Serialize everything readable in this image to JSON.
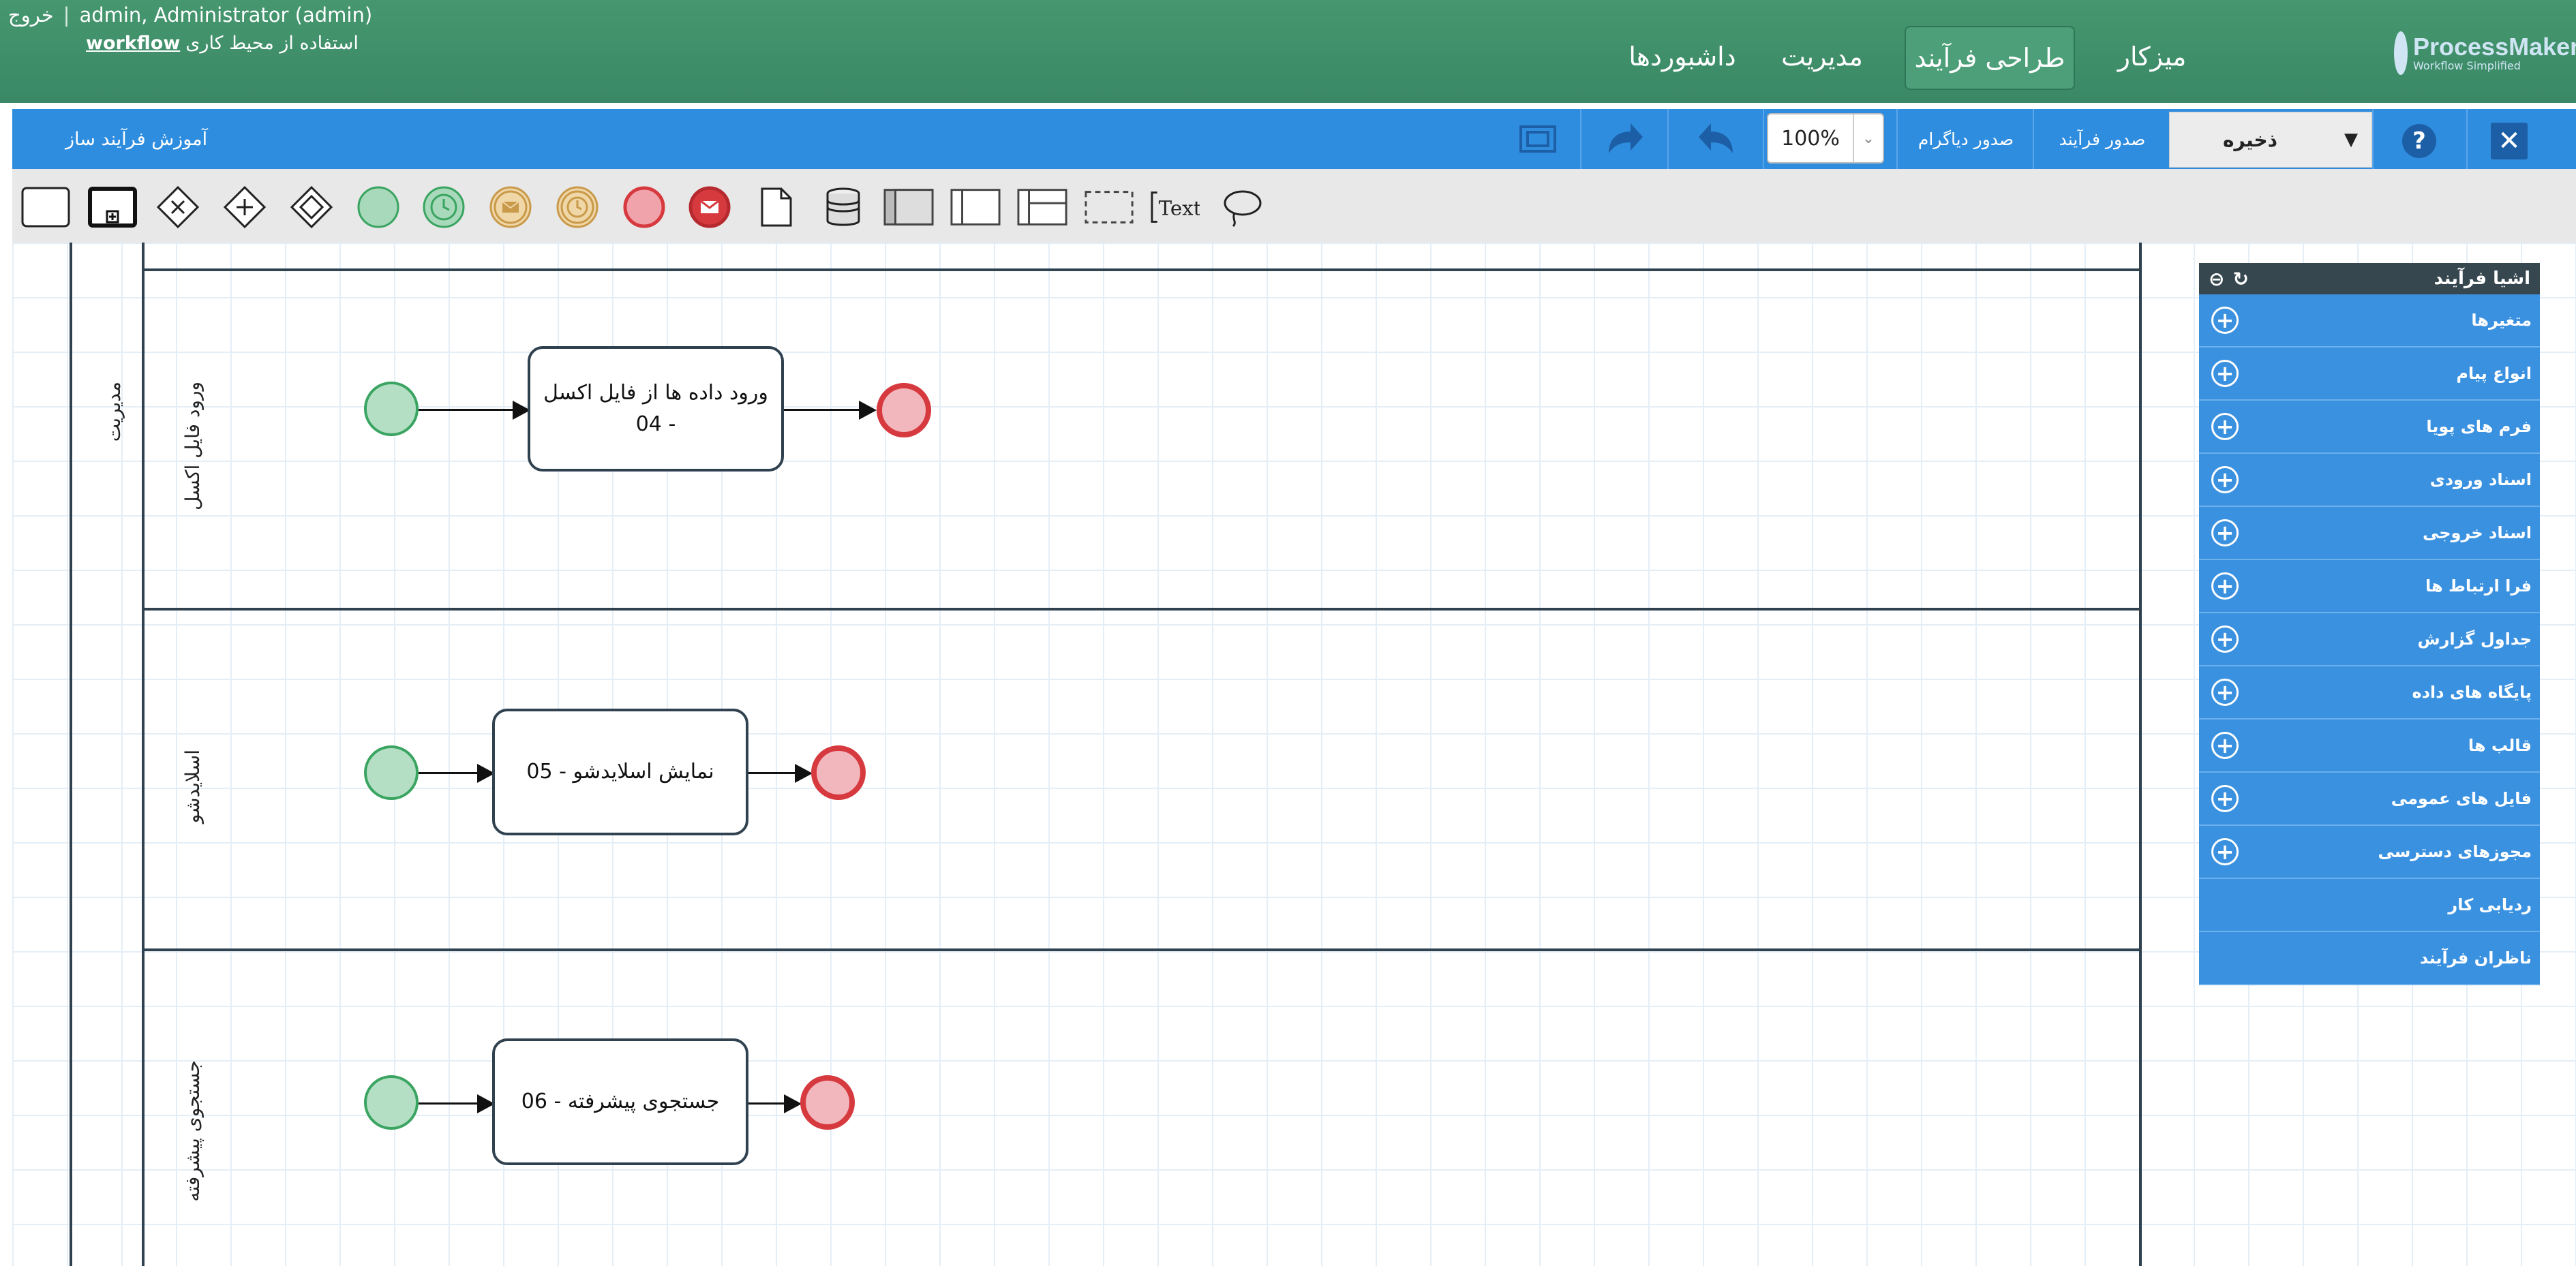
{
  "header": {
    "logout": "خروج",
    "user": "admin, Administrator (admin)",
    "workspace_prefix": "استفاده از محیط کاری",
    "workspace_name": "workflow",
    "nav": [
      {
        "label": "میزکار"
      },
      {
        "label": "طراحی فرآیند",
        "active": true
      },
      {
        "label": "مدیریت"
      },
      {
        "label": "داشبوردها"
      }
    ],
    "logo_name": "ProcessMaker",
    "logo_tag": "Workflow Simplified"
  },
  "toolbar": {
    "title": "آموزش فرآیند ساز",
    "zoom": "100%",
    "export_diagram": "صدور دیاگرام",
    "export_process": "صدور فرآیند",
    "save": "ذخیره",
    "help": "?",
    "close": "✕"
  },
  "shapes": [
    {
      "name": "task-shape"
    },
    {
      "name": "subprocess-shape"
    },
    {
      "name": "exclusive-gateway"
    },
    {
      "name": "parallel-gateway"
    },
    {
      "name": "inclusive-gateway"
    },
    {
      "name": "start-event"
    },
    {
      "name": "start-timer-event"
    },
    {
      "name": "start-message-event"
    },
    {
      "name": "intermediate-timer-event"
    },
    {
      "name": "end-event"
    },
    {
      "name": "end-message-event"
    },
    {
      "name": "data-object"
    },
    {
      "name": "data-store"
    },
    {
      "name": "pool-horizontal"
    },
    {
      "name": "pool-vertical"
    },
    {
      "name": "lane"
    },
    {
      "name": "group"
    },
    {
      "name": "text-annotation",
      "label": "Text"
    },
    {
      "name": "lasso-tool"
    }
  ],
  "pool": {
    "label": "مدیریت"
  },
  "lanes": [
    {
      "label": "ورود فایل اکسل",
      "task": "ورود داده ها از فایل اکسل - 04"
    },
    {
      "label": "اسلایدشو",
      "task": "نمایش اسلایدشو - 05"
    },
    {
      "label": "جستجوی پیشرفته",
      "task": "جستجوی پیشرفته - 06"
    }
  ],
  "panel": {
    "title": "اشیا فرآیند",
    "items": [
      {
        "label": "متغیرها",
        "addable": true
      },
      {
        "label": "انواع پیام",
        "addable": true
      },
      {
        "label": "فرم های پویا",
        "addable": true
      },
      {
        "label": "اسناد ورودی",
        "addable": true
      },
      {
        "label": "اسناد خروجی",
        "addable": true
      },
      {
        "label": "فرا ارتباط ها",
        "addable": true
      },
      {
        "label": "جداول گزارش",
        "addable": true
      },
      {
        "label": "پایگاه های داده",
        "addable": true
      },
      {
        "label": "قالب ها",
        "addable": true
      },
      {
        "label": "فایل های عمومی",
        "addable": true
      },
      {
        "label": "مجوزهای دسترسی",
        "addable": true
      },
      {
        "label": "ردیابی کار",
        "addable": false
      },
      {
        "label": "ناظران فرآیند",
        "addable": false
      }
    ]
  },
  "colors": {
    "header": "#3f8f6e",
    "toolbar": "#2f8ddf",
    "start_event": "#3aa461",
    "end_event": "#d63a3f"
  }
}
